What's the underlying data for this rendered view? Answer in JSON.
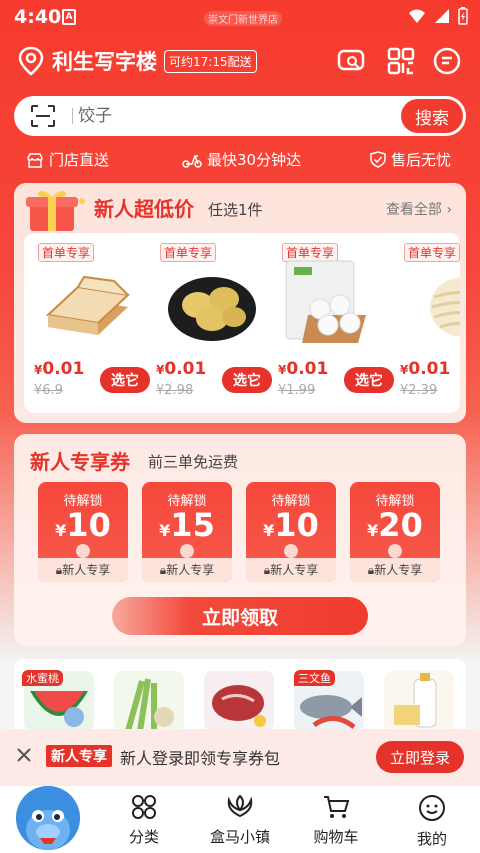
{
  "status": {
    "time": "4:40",
    "app_icon": "A",
    "store_label": "崇文门新世界店"
  },
  "header": {
    "location": "利生写字楼",
    "delivery": "可约17:15配送",
    "icons": [
      "location-pin-icon",
      "chat-search-icon",
      "qr-code-icon",
      "message-icon"
    ]
  },
  "search": {
    "placeholder": "饺子",
    "button": "搜索"
  },
  "features": [
    "门店直送",
    "最快30分钟达",
    "售后无忧"
  ],
  "deal": {
    "title": "新人超低价",
    "subtitle": "任选1件",
    "view_all": "查看全部",
    "products": [
      {
        "badge": "首单专享",
        "price": "0.01",
        "currency": "¥",
        "old_price": "¥6.9",
        "button": "选它",
        "icon": "toast-bread-icon"
      },
      {
        "badge": "首单专享",
        "price": "0.01",
        "currency": "¥",
        "old_price": "¥2.98",
        "button": "选它",
        "icon": "potato-icon"
      },
      {
        "badge": "首单专享",
        "price": "0.01",
        "currency": "¥",
        "old_price": "¥1.99",
        "button": "选它",
        "icon": "steamed-bun-icon"
      },
      {
        "badge": "首单专享",
        "price": "0.01",
        "currency": "¥",
        "old_price": "¥2.39",
        "button": "选它",
        "icon": "noodles-icon"
      }
    ]
  },
  "coupons": {
    "title": "新人专享券",
    "subtitle": "前三单免运费",
    "items": [
      {
        "status": "待解锁",
        "currency": "¥",
        "amount": "10",
        "label": "新人专享"
      },
      {
        "status": "待解锁",
        "currency": "¥",
        "amount": "15",
        "label": "新人专享"
      },
      {
        "status": "待解锁",
        "currency": "¥",
        "amount": "10",
        "label": "新人专享"
      },
      {
        "status": "待解锁",
        "currency": "¥",
        "amount": "20",
        "label": "新人专享"
      }
    ],
    "claim_button": "立即领取"
  },
  "categories": [
    {
      "tag": "水蜜桃",
      "icon": "watermelon-icon"
    },
    {
      "tag": "",
      "icon": "vegetables-icon"
    },
    {
      "tag": "",
      "icon": "steak-icon"
    },
    {
      "tag": "三文鱼",
      "icon": "fish-icon"
    },
    {
      "tag": "",
      "icon": "milk-icon"
    }
  ],
  "login_banner": {
    "tag": "新人专享",
    "text": "新人登录即领专享券包",
    "button": "立即登录"
  },
  "nav": [
    {
      "label": "分类",
      "icon": "category-icon"
    },
    {
      "label": "盒马小镇",
      "icon": "town-icon"
    },
    {
      "label": "购物车",
      "icon": "cart-icon"
    },
    {
      "label": "我的",
      "icon": "profile-icon"
    }
  ],
  "colors": {
    "brand_red": "#e5322a",
    "header_red": "#f63b2e",
    "nav_blue": "#3b8ee0"
  }
}
